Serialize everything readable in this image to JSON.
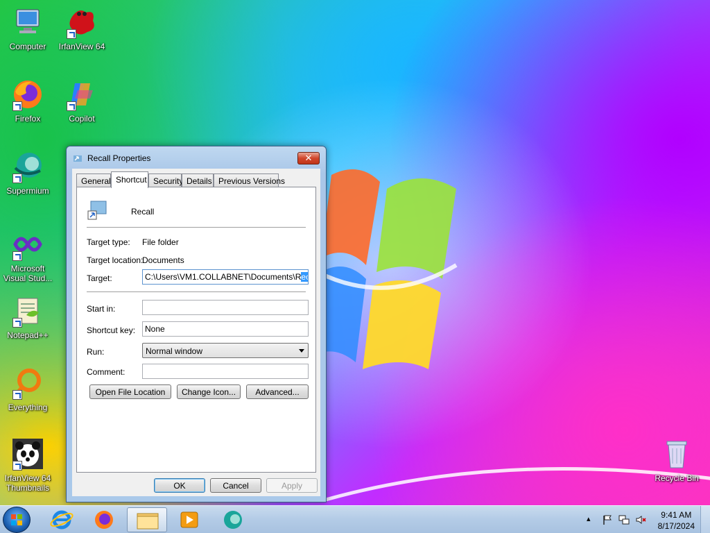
{
  "desktop": {
    "icons": [
      {
        "label": "Computer"
      },
      {
        "label": "IrfanView 64"
      },
      {
        "label": "Firefox"
      },
      {
        "label": "Copilot"
      },
      {
        "label": "Supermium"
      },
      {
        "label": "Microsoft Visual Stud..."
      },
      {
        "label": "Notepad++"
      },
      {
        "label": "Everything"
      },
      {
        "label": "IrfanView 64 Thumbnails"
      },
      {
        "label": "Recycle Bin"
      }
    ]
  },
  "dialog": {
    "title": "Recall Properties",
    "close_label": "✕",
    "tabs": [
      {
        "label": "General"
      },
      {
        "label": "Shortcut"
      },
      {
        "label": "Security"
      },
      {
        "label": "Details"
      },
      {
        "label": "Previous Versions"
      }
    ],
    "active_tab": "Shortcut",
    "shortcut_name": "Recall",
    "target_type_label": "Target type:",
    "target_type_value": "File folder",
    "target_location_label": "Target location:",
    "target_location_value": "Documents",
    "target_label": "Target:",
    "target_value_prefix": "C:\\Users\\VM1.COLLABNET\\Documents\\R",
    "target_value_selected": "ecall",
    "start_in_label": "Start in:",
    "start_in_value": "",
    "shortcut_key_label": "Shortcut key:",
    "shortcut_key_value": "None",
    "run_label": "Run:",
    "run_value": "Normal window",
    "comment_label": "Comment:",
    "comment_value": "",
    "buttons": {
      "open_file_location": "Open File Location",
      "change_icon": "Change Icon...",
      "advanced": "Advanced...",
      "ok": "OK",
      "cancel": "Cancel",
      "apply": "Apply"
    }
  },
  "taskbar": {
    "time": "9:41 AM",
    "date": "8/17/2024",
    "tray_expand": "▴",
    "pinned": [
      "internet-explorer-icon",
      "firefox-icon",
      "file-explorer-icon",
      "media-player-icon",
      "supermium-icon"
    ]
  }
}
